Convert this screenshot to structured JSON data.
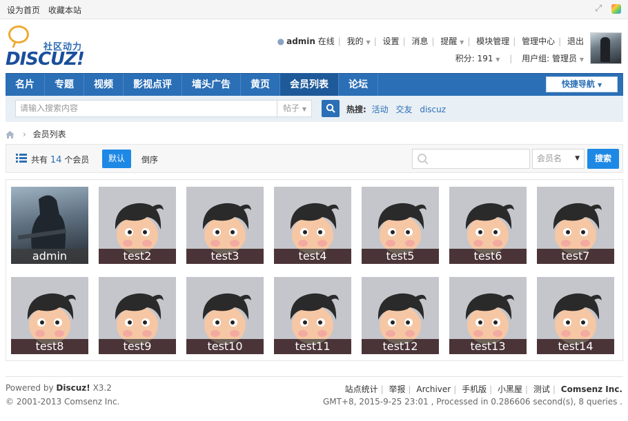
{
  "topbar": {
    "set_home": "设为首页",
    "bookmark": "收藏本站",
    "icons": [
      "expand-icon",
      "color-scheme-icon"
    ]
  },
  "logo": {
    "subtitle": "社区动力",
    "brand": "DISCUZ!"
  },
  "userbar": {
    "username": "admin",
    "online": "在线",
    "links": [
      "我的",
      "设置",
      "消息",
      "提醒",
      "模块管理",
      "管理中心",
      "退出"
    ],
    "points": "积分: 191",
    "group": "用户组: 管理员"
  },
  "nav": {
    "items": [
      "名片",
      "专题",
      "视频",
      "影视点评",
      "墙头广告",
      "黄页",
      "会员列表",
      "论坛"
    ],
    "active": "会员列表",
    "quick_nav": "快捷导航"
  },
  "search": {
    "placeholder": "请输入搜索内容",
    "type": "帖子",
    "hot_label": "热搜:",
    "hot_keywords": [
      "活动",
      "交友",
      "discuz"
    ]
  },
  "breadcrumb": {
    "current": "会员列表"
  },
  "toolbar": {
    "count_prefix": "共有",
    "count": "14",
    "count_suffix": "个会员",
    "default_label": "默认",
    "reverse_label": "倒序",
    "field": "会员名",
    "search_label": "搜索"
  },
  "members": [
    "admin",
    "test2",
    "test3",
    "test4",
    "test5",
    "test6",
    "test7",
    "test8",
    "test9",
    "test10",
    "test11",
    "test12",
    "test13",
    "test14"
  ],
  "footer": {
    "powered_prefix": "Powered by",
    "powered_brand": "Discuz!",
    "powered_version": "X3.2",
    "copyright": "© 2001-2013 Comsenz Inc.",
    "links": [
      "站点统计",
      "举报",
      "Archiver",
      "手机版",
      "小黑屋",
      "测试"
    ],
    "company": "Comsenz Inc.",
    "processed": "GMT+8, 2015-9-25 23:01 , Processed in 0.286606 second(s), 8 queries ."
  }
}
